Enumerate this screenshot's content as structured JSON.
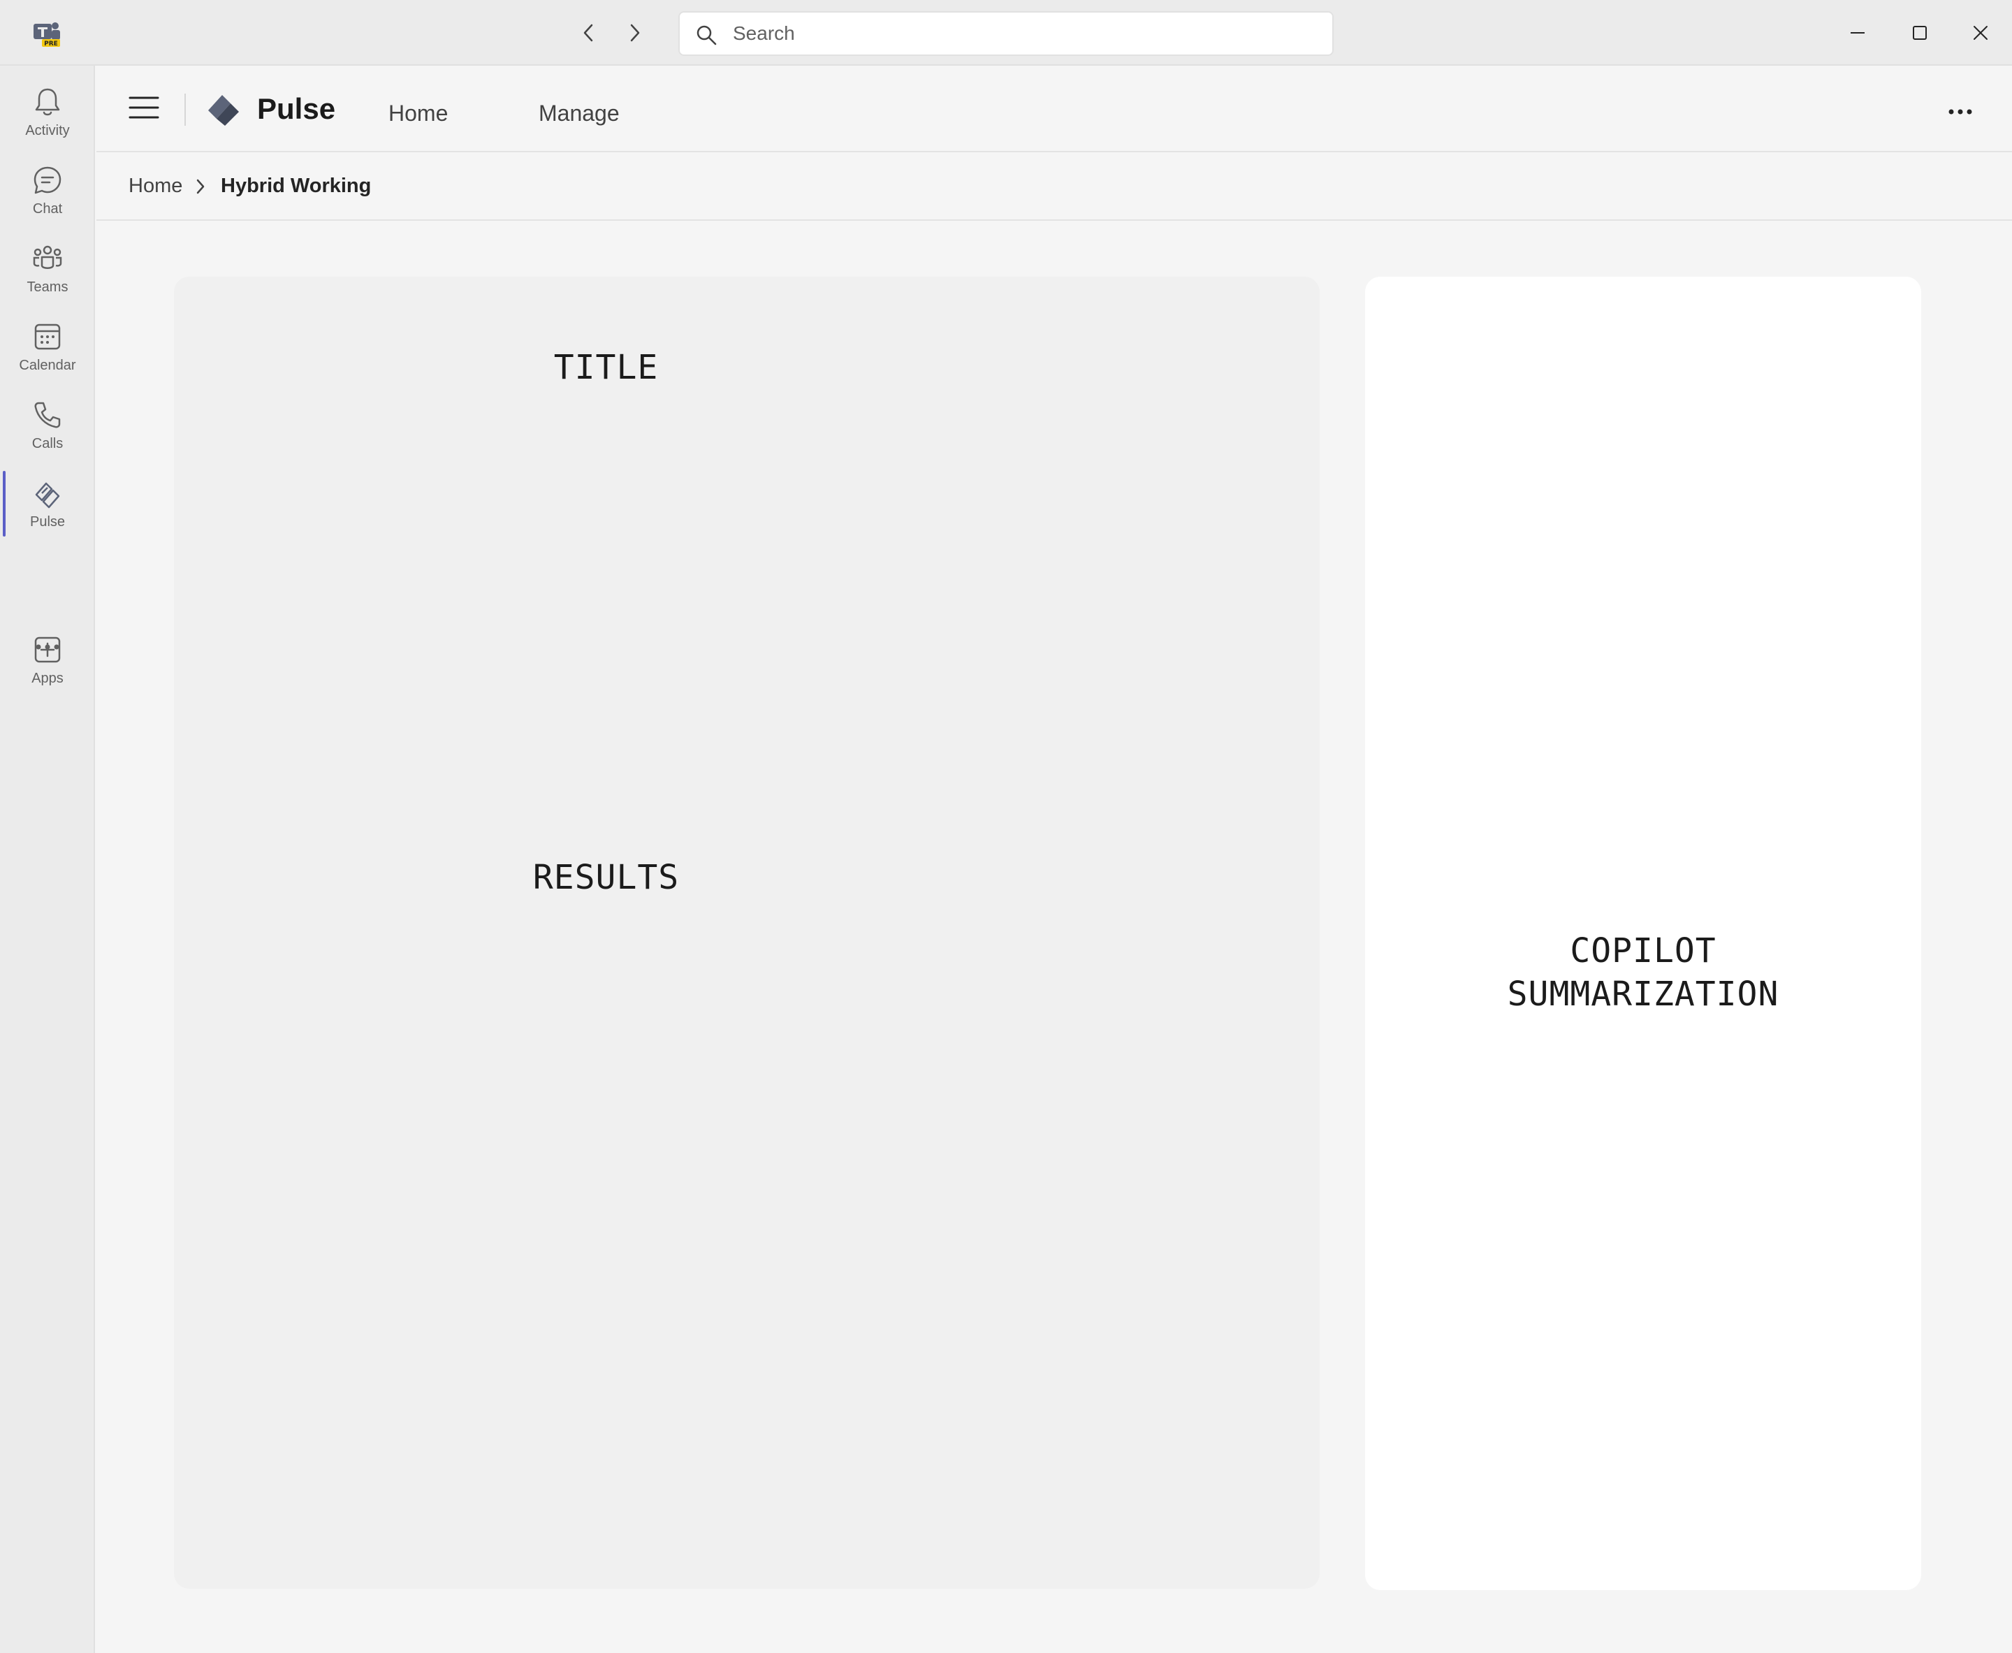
{
  "titlebar": {
    "search_placeholder": "Search",
    "logo_badge": "PRE"
  },
  "rail": {
    "items": [
      {
        "label": "Activity",
        "icon": "bell-icon"
      },
      {
        "label": "Chat",
        "icon": "chat-icon"
      },
      {
        "label": "Teams",
        "icon": "teams-icon"
      },
      {
        "label": "Calendar",
        "icon": "calendar-icon"
      },
      {
        "label": "Calls",
        "icon": "phone-icon"
      },
      {
        "label": "Pulse",
        "icon": "pulse-icon",
        "active": true
      },
      {
        "label": "Apps",
        "icon": "add-app-icon"
      }
    ],
    "accent_color": "#5b5fc7"
  },
  "header": {
    "app_name": "Pulse",
    "tabs": [
      {
        "label": "Home"
      },
      {
        "label": "Manage"
      }
    ]
  },
  "breadcrumb": {
    "home": "Home",
    "current": "Hybrid Working"
  },
  "main": {
    "title_placeholder": "TITLE",
    "results_placeholder": "RESULTS",
    "copilot_placeholder": "COPILOT\nSUMMARIZATION"
  }
}
